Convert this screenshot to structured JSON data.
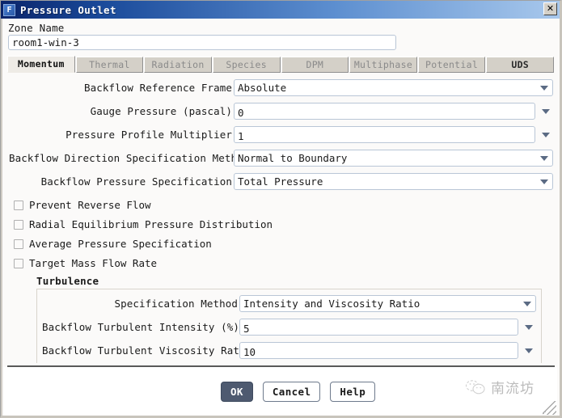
{
  "window": {
    "title": "Pressure Outlet",
    "app_icon_letter": "F",
    "close_label": "✕"
  },
  "zone": {
    "label": "Zone Name",
    "value": "room1-win-3"
  },
  "tabs": [
    {
      "label": "Momentum",
      "active": true,
      "dark": false
    },
    {
      "label": "Thermal",
      "active": false,
      "dark": false
    },
    {
      "label": "Radiation",
      "active": false,
      "dark": false
    },
    {
      "label": "Species",
      "active": false,
      "dark": false
    },
    {
      "label": "DPM",
      "active": false,
      "dark": false
    },
    {
      "label": "Multiphase",
      "active": false,
      "dark": false
    },
    {
      "label": "Potential",
      "active": false,
      "dark": false
    },
    {
      "label": "UDS",
      "active": false,
      "dark": true
    }
  ],
  "momentum": {
    "rows": [
      {
        "label": "Backflow Reference Frame",
        "value": "Absolute",
        "kind": "combo",
        "label_width": 278
      },
      {
        "label": "Gauge Pressure  (pascal)",
        "value": "0",
        "kind": "spin",
        "label_width": 278
      },
      {
        "label": "Pressure Profile Multiplier",
        "value": "1",
        "kind": "spin",
        "label_width": 278
      },
      {
        "label": "Backflow Direction Specification Method",
        "value": "Normal to Boundary",
        "kind": "combo",
        "label_width": 278
      },
      {
        "label": "Backflow Pressure Specification",
        "value": "Total Pressure",
        "kind": "combo",
        "label_width": 278
      }
    ],
    "checkboxes": [
      {
        "label": "Prevent Reverse Flow",
        "checked": false
      },
      {
        "label": "Radial Equilibrium Pressure Distribution",
        "checked": false
      },
      {
        "label": "Average Pressure Specification",
        "checked": false
      },
      {
        "label": "Target Mass Flow Rate",
        "checked": false
      }
    ]
  },
  "turbulence": {
    "title": "Turbulence",
    "rows": [
      {
        "label": "Specification Method",
        "value": "Intensity and Viscosity Ratio",
        "kind": "combo",
        "label_width": 244
      },
      {
        "label": "Backflow Turbulent Intensity (%)",
        "value": "5",
        "kind": "spin",
        "label_width": 244
      },
      {
        "label": "Backflow Turbulent Viscosity Ratio",
        "value": "10",
        "kind": "spin",
        "label_width": 244
      }
    ]
  },
  "footer": {
    "buttons": [
      {
        "label": "OK",
        "style": "primary"
      },
      {
        "label": "Cancel",
        "style": "normal"
      },
      {
        "label": "Help",
        "style": "normal"
      }
    ],
    "watermark_text": "南流坊"
  },
  "colors": {
    "title_bar_start": "#0a246a",
    "title_bar_end": "#a8c8ec",
    "accent_button": "#4e5a70",
    "field_border": "#b9c6d6",
    "arrow": "#5b6b84",
    "tab_face": "#d4d0c8",
    "dialog_bg": "#fbfaf9"
  }
}
